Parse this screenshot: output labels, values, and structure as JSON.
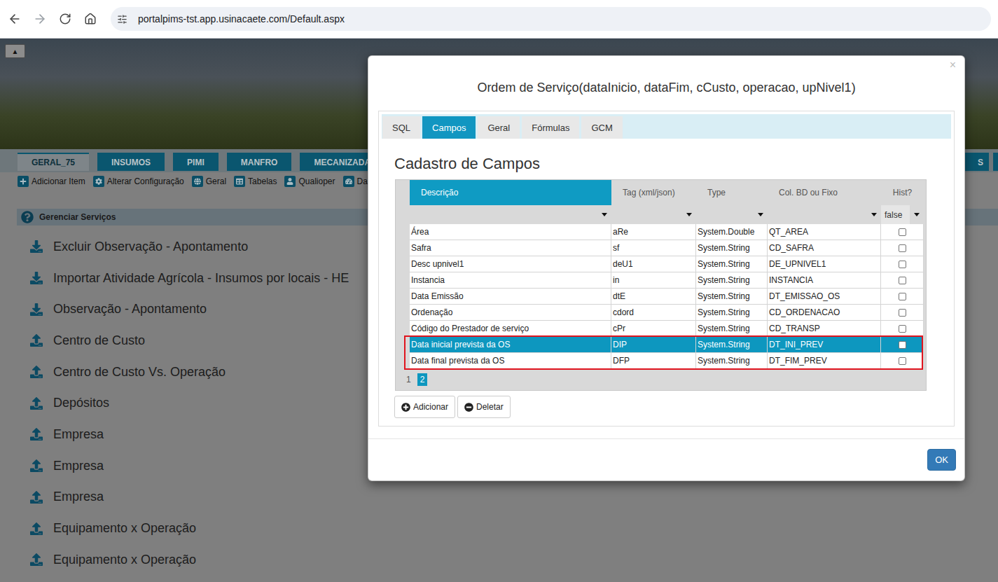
{
  "browser": {
    "url": "portalpims-tst.app.usinacaete.com/Default.aspx"
  },
  "page": {
    "collapse_button": "▲",
    "tabs": [
      {
        "label": "GERAL_75",
        "selected": true
      },
      {
        "label": "INSUMOS",
        "selected": false
      },
      {
        "label": "PIMI",
        "selected": false
      },
      {
        "label": "MANFRO",
        "selected": false
      },
      {
        "label": "MECANIZADA",
        "selected": false
      }
    ],
    "right_tabs": [
      {
        "label": "S",
        "selected": false
      }
    ],
    "toolbar": [
      {
        "label": "Adicionar Item",
        "kind": "add"
      },
      {
        "label": "Alterar Configuração",
        "kind": "settings"
      },
      {
        "label": "Geral",
        "kind": "globe"
      },
      {
        "label": "Tabelas",
        "kind": "table"
      },
      {
        "label": "Qualioper",
        "kind": "user"
      },
      {
        "label": "Dashb",
        "kind": "dashboard"
      }
    ],
    "panel": {
      "title": "Gerenciar Serviços",
      "items": [
        {
          "label": "Excluir Observação - Apontamento",
          "kind": "download"
        },
        {
          "label": "Importar Atividade Agrícola - Insumos por locais - HE",
          "kind": "download"
        },
        {
          "label": "Observação - Apontamento",
          "kind": "download"
        },
        {
          "label": "Centro de Custo",
          "kind": "upload"
        },
        {
          "label": "Centro de Custo Vs. Operação",
          "kind": "upload"
        },
        {
          "label": "Depósitos",
          "kind": "upload"
        },
        {
          "label": "Empresa",
          "kind": "upload"
        },
        {
          "label": "Empresa",
          "kind": "upload"
        },
        {
          "label": "Empresa",
          "kind": "upload"
        },
        {
          "label": "Equipamento x Operação",
          "kind": "upload"
        },
        {
          "label": "Equipamento x Operação",
          "kind": "upload"
        }
      ]
    }
  },
  "dialog": {
    "title": "Ordem de Serviço(dataInicio, dataFim, cCusto, operacao, upNivel1)",
    "close": "×",
    "tabs": [
      {
        "label": "SQL",
        "selected": false
      },
      {
        "label": "Campos",
        "selected": true
      },
      {
        "label": "Geral",
        "selected": false
      },
      {
        "label": "Fórmulas",
        "selected": false
      },
      {
        "label": "GCM",
        "selected": false
      }
    ],
    "heading": "Cadastro de Campos",
    "grid": {
      "columns": [
        {
          "label": "Descrição",
          "selected": true
        },
        {
          "label": "Tag (xml/json)",
          "selected": false
        },
        {
          "label": "Type",
          "selected": false
        },
        {
          "label": "Col. BD ou Fixo",
          "selected": false
        },
        {
          "label": "Hist?",
          "selected": false
        }
      ],
      "hist_filter": "false",
      "rows": [
        {
          "cells": [
            "Área",
            "aRe",
            "System.Double",
            "QT_AREA"
          ],
          "hist": false,
          "selected": false,
          "annotated": false
        },
        {
          "cells": [
            "Safra",
            "sf",
            "System.String",
            "CD_SAFRA"
          ],
          "hist": false,
          "selected": false,
          "annotated": false
        },
        {
          "cells": [
            "Desc upnivel1",
            "deU1",
            "System.String",
            "DE_UPNIVEL1"
          ],
          "hist": false,
          "selected": false,
          "annotated": false
        },
        {
          "cells": [
            "Instancia",
            "in",
            "System.String",
            "INSTANCIA"
          ],
          "hist": false,
          "selected": false,
          "annotated": false
        },
        {
          "cells": [
            "Data Emissão",
            "dtE",
            "System.String",
            "DT_EMISSAO_OS"
          ],
          "hist": false,
          "selected": false,
          "annotated": false
        },
        {
          "cells": [
            "Ordenação",
            "cdord",
            "System.String",
            "CD_ORDENACAO"
          ],
          "hist": false,
          "selected": false,
          "annotated": false
        },
        {
          "cells": [
            "Código do Prestador de serviço",
            "cPr",
            "System.String",
            "CD_TRANSP"
          ],
          "hist": false,
          "selected": false,
          "annotated": false
        },
        {
          "cells": [
            "Data inicial prevista da OS",
            "DIP",
            "System.String",
            "DT_INI_PREV"
          ],
          "hist": false,
          "selected": true,
          "annotated": true
        },
        {
          "cells": [
            "Data final prevista da OS",
            "DFP",
            "System.String",
            "DT_FIM_PREV"
          ],
          "hist": false,
          "selected": false,
          "annotated": true
        }
      ],
      "pages": [
        {
          "label": "1",
          "selected": false
        },
        {
          "label": "2",
          "selected": true
        }
      ]
    },
    "actions": [
      {
        "label": "Adicionar",
        "kind": "add"
      },
      {
        "label": "Deletar",
        "kind": "delete"
      }
    ],
    "ok": "OK"
  }
}
